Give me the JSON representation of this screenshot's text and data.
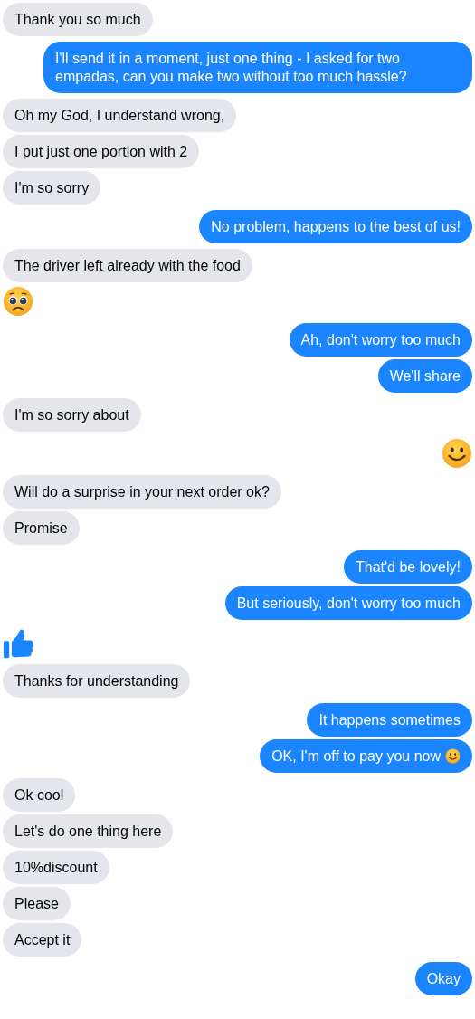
{
  "messages": [
    {
      "outgoing": false,
      "kind": "text",
      "text": "Thank you so much"
    },
    {
      "outgoing": true,
      "kind": "text",
      "text": "I'll send it in a moment, just one thing - I asked for two empadas, can you make two without too much hassle?"
    },
    {
      "outgoing": false,
      "kind": "text",
      "text": "Oh my God, I understand wrong,"
    },
    {
      "outgoing": false,
      "kind": "text",
      "text": "I put just one portion with 2"
    },
    {
      "outgoing": false,
      "kind": "text",
      "text": "I'm so sorry"
    },
    {
      "outgoing": true,
      "kind": "text",
      "text": "No problem, happens to the best of us!"
    },
    {
      "outgoing": false,
      "kind": "text",
      "text": "The driver left already with the food"
    },
    {
      "outgoing": false,
      "kind": "sad"
    },
    {
      "outgoing": true,
      "kind": "text",
      "text": "Ah, don't worry too much"
    },
    {
      "outgoing": true,
      "kind": "text",
      "text": "We'll share"
    },
    {
      "outgoing": false,
      "kind": "text",
      "text": "I'm so sorry about"
    },
    {
      "outgoing": true,
      "kind": "smile"
    },
    {
      "outgoing": false,
      "kind": "text",
      "text": "Will do a surprise in your next order ok?"
    },
    {
      "outgoing": false,
      "kind": "text",
      "text": "Promise"
    },
    {
      "outgoing": true,
      "kind": "text",
      "text": "That'd be lovely!"
    },
    {
      "outgoing": true,
      "kind": "text",
      "text": "But seriously, don't worry too much"
    },
    {
      "outgoing": false,
      "kind": "like"
    },
    {
      "outgoing": false,
      "kind": "text",
      "text": "Thanks for understanding"
    },
    {
      "outgoing": true,
      "kind": "text",
      "text": "It happens sometimes"
    },
    {
      "outgoing": true,
      "kind": "text",
      "text": "OK, I'm off to pay you now",
      "smile_after": true
    },
    {
      "outgoing": false,
      "kind": "text",
      "text": "Ok cool"
    },
    {
      "outgoing": false,
      "kind": "text",
      "text": "Let's do one thing here"
    },
    {
      "outgoing": false,
      "kind": "text",
      "text": "10%discount"
    },
    {
      "outgoing": false,
      "kind": "text",
      "text": "Please"
    },
    {
      "outgoing": false,
      "kind": "text",
      "text": "Accept it"
    },
    {
      "outgoing": true,
      "kind": "text",
      "text": "Okay"
    }
  ]
}
